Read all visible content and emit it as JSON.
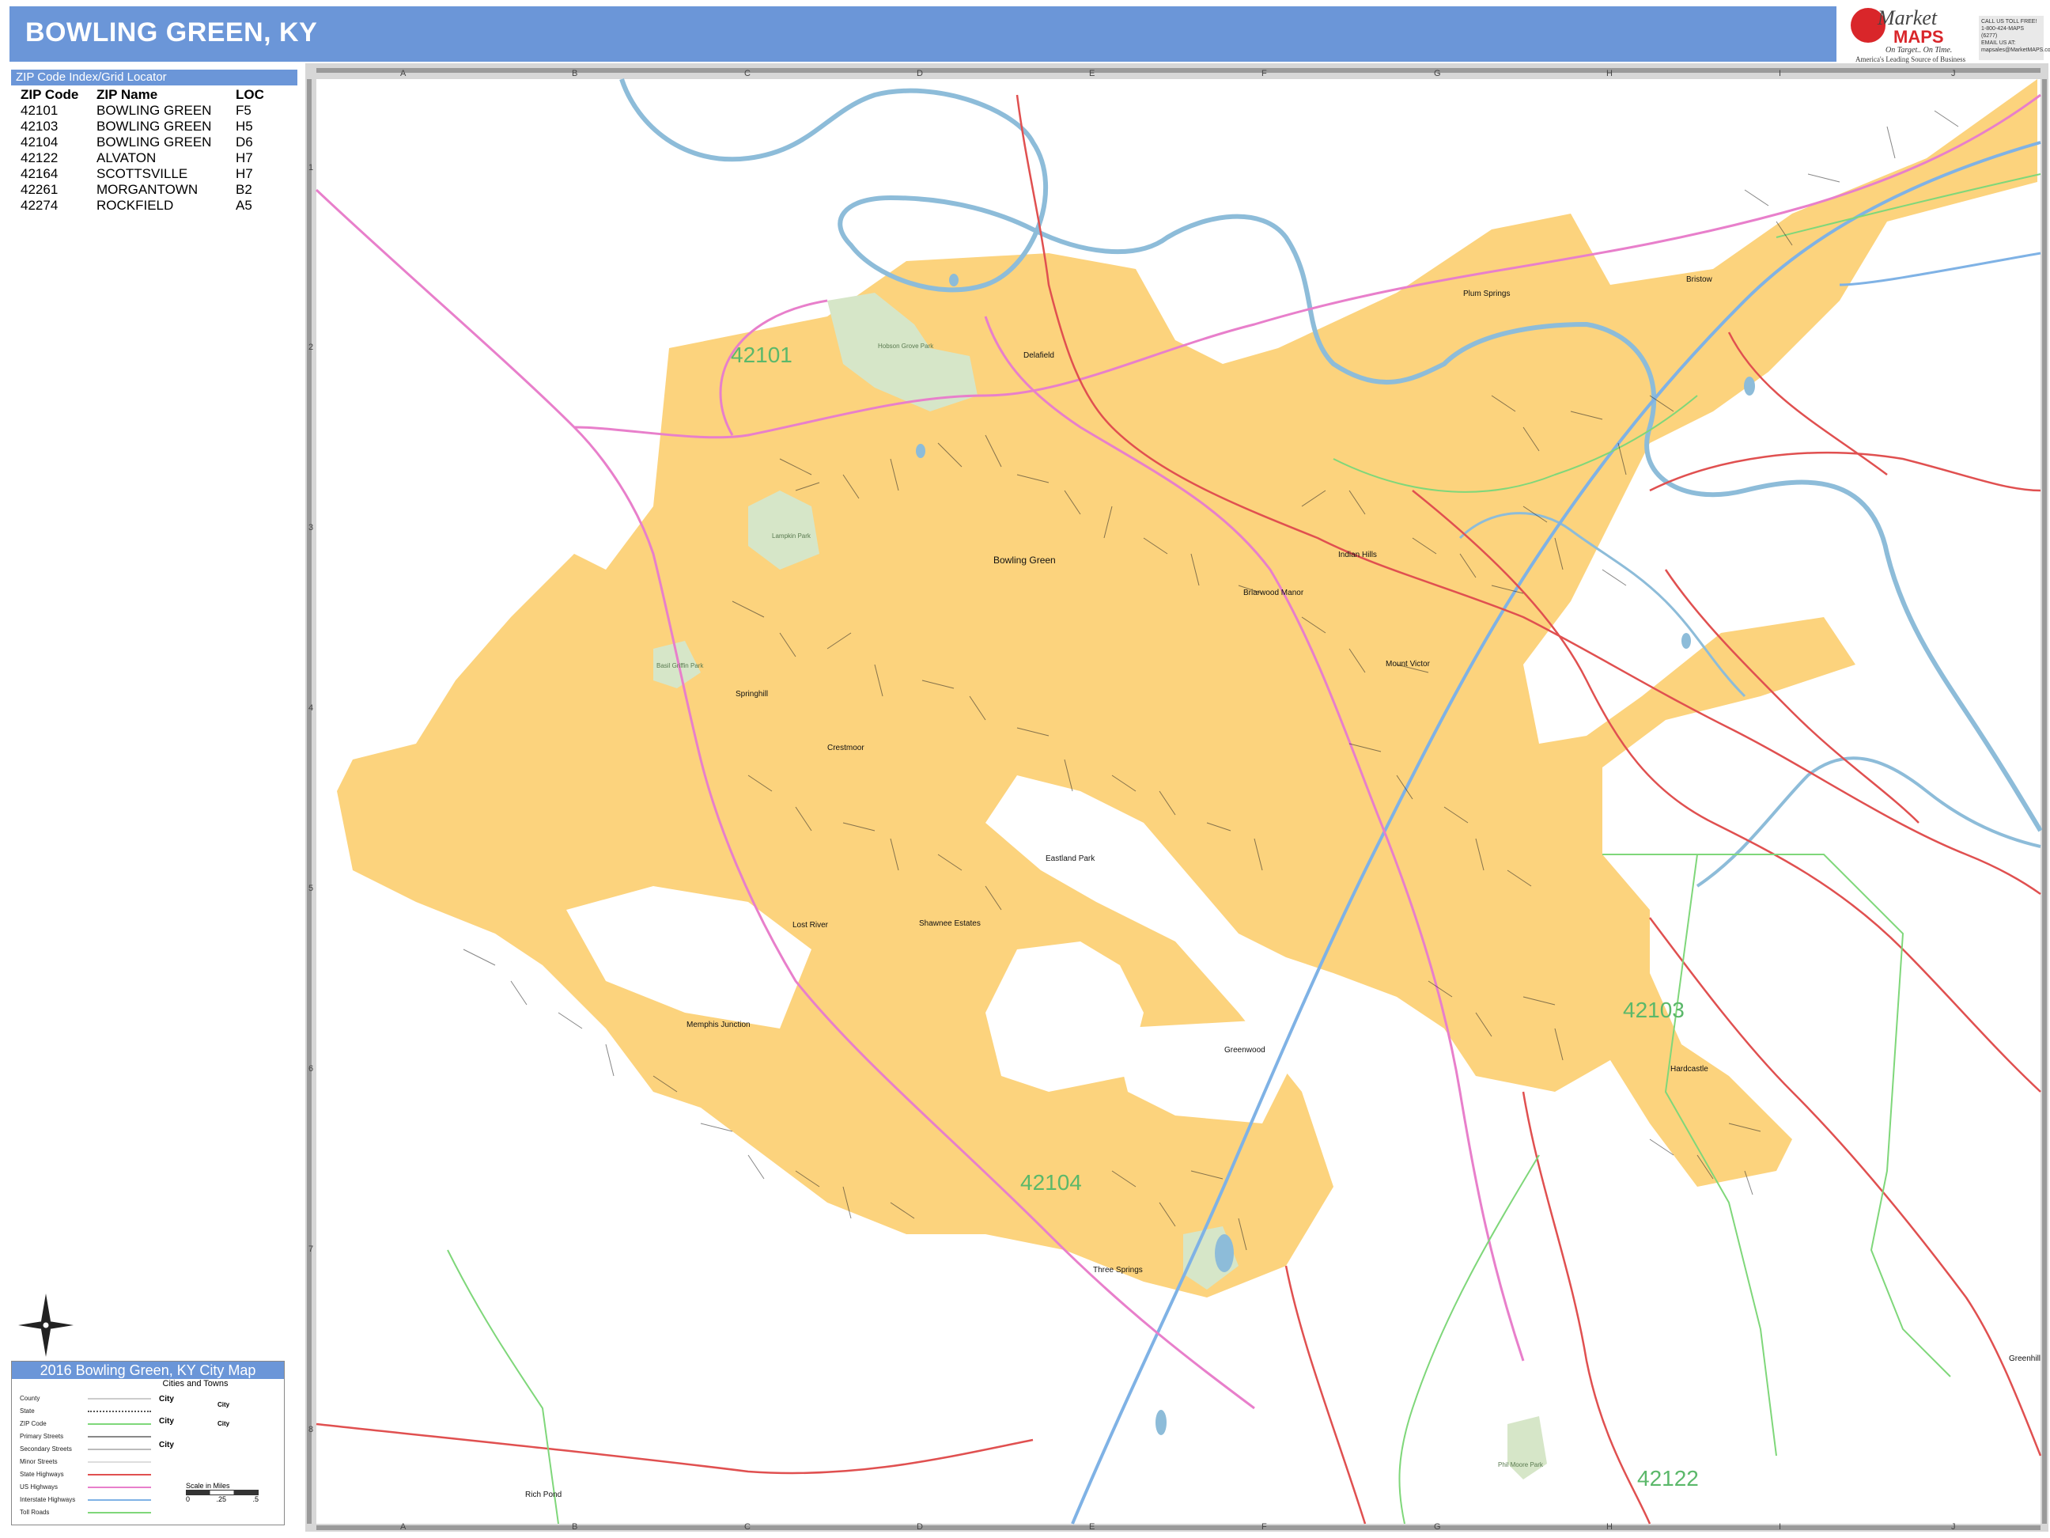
{
  "title": "BOWLING GREEN, KY",
  "logo": {
    "line1": "Market",
    "line2": "MAPS",
    "tagline": "On Target.. On Time.",
    "subtitle": "America's Leading Source of Business Maps",
    "contact": [
      "CALL US TOLL FREE!",
      "1-800-424-MAPS (6277)",
      "EMAIL US AT:",
      "mapsales@MarketMAPS.com"
    ]
  },
  "zip_index": {
    "header": "ZIP Code Index/Grid Locator",
    "columns": [
      "ZIP Code",
      "ZIP Name",
      "LOC"
    ],
    "rows": [
      [
        "42101",
        "BOWLING GREEN",
        "F5"
      ],
      [
        "42103",
        "BOWLING GREEN",
        "H5"
      ],
      [
        "42104",
        "BOWLING GREEN",
        "D6"
      ],
      [
        "42122",
        "ALVATON",
        "H7"
      ],
      [
        "42164",
        "SCOTTSVILLE",
        "H7"
      ],
      [
        "42261",
        "MORGANTOWN",
        "B2"
      ],
      [
        "42274",
        "ROCKFIELD",
        "A5"
      ]
    ]
  },
  "grid": {
    "columns": [
      "A",
      "B",
      "C",
      "D",
      "E",
      "F",
      "G",
      "H",
      "I",
      "J"
    ],
    "rows": [
      "1",
      "2",
      "3",
      "4",
      "5",
      "6",
      "7",
      "8"
    ]
  },
  "zip_labels": [
    "42101",
    "42103",
    "42104",
    "42122"
  ],
  "places": [
    "Bowling Green",
    "Plum Springs",
    "Bristow",
    "Delafield",
    "Indian Hills",
    "Briarwood Manor",
    "Mount Victor",
    "Springhill",
    "Crestmoor",
    "Eastland Park",
    "Shawnee Estates",
    "Lost River",
    "Memphis Junction",
    "Greenwood",
    "Three Springs",
    "Hardcastle",
    "Greenhill",
    "Rich Pond"
  ],
  "parks": [
    "Hobson Grove Park",
    "Lampkin Park",
    "Basil Griffin Park",
    "Phil Moore Park"
  ],
  "legend": {
    "title": "2016 Bowling Green, KY City Map",
    "cities_header": "Cities and Towns",
    "items": [
      "County",
      "State",
      "ZIP Code",
      "Primary Streets",
      "Secondary Streets",
      "Minor Streets",
      "State Highways",
      "US Highways",
      "Interstate Highways",
      "Toll Roads"
    ],
    "city_samples": [
      "City",
      "City",
      "City",
      "City",
      "City"
    ],
    "scale_label": "Scale in Miles",
    "scale_ticks": [
      "0",
      ".25",
      ".5"
    ]
  },
  "colors": {
    "title_bar": "#6b96d8",
    "city_area": "#fcd37d",
    "water": "#8dbcd9",
    "park": "#d6e6c8",
    "state_highway": "#e05050",
    "us_highway": "#e87fcb",
    "interstate": "#7fb2e5",
    "zip_boundary": "#7fd77a",
    "zip_label": "#5bb86a"
  }
}
